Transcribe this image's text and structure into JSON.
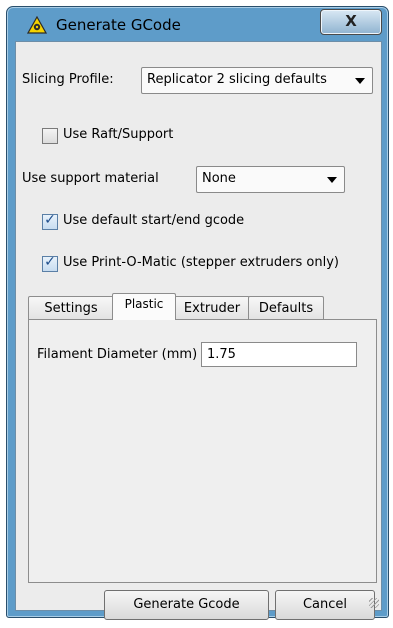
{
  "window": {
    "title": "Generate GCode",
    "close_label": "X"
  },
  "slicing_profile": {
    "label": "Slicing Profile:",
    "value": "Replicator 2 slicing defaults"
  },
  "options": {
    "raft_support": {
      "label": "Use Raft/Support",
      "checked": false
    },
    "support_material": {
      "label": "Use support material",
      "value": "None"
    },
    "default_gcode": {
      "label": "Use default start/end gcode",
      "checked": true
    },
    "print_o_matic": {
      "label": "Use Print-O-Matic (stepper extruders only)",
      "checked": true
    }
  },
  "tabs": [
    {
      "label": "Settings",
      "active": false
    },
    {
      "label": "Plastic",
      "active": true
    },
    {
      "label": "Extruder",
      "active": false
    },
    {
      "label": "Defaults",
      "active": false
    }
  ],
  "plastic_panel": {
    "filament_label": "Filament Diameter (mm)",
    "filament_value": "1.75"
  },
  "buttons": {
    "generate": "Generate Gcode",
    "cancel": "Cancel"
  },
  "colors": {
    "frame": "#5e9cc9",
    "client_bg": "#ececec",
    "checkmark": "#1f4e8c"
  },
  "icons": {
    "window_icon": "warning-triangle-icon",
    "close": "close-icon",
    "dropdown": "chevron-down-icon",
    "check": "checkmark-icon"
  }
}
